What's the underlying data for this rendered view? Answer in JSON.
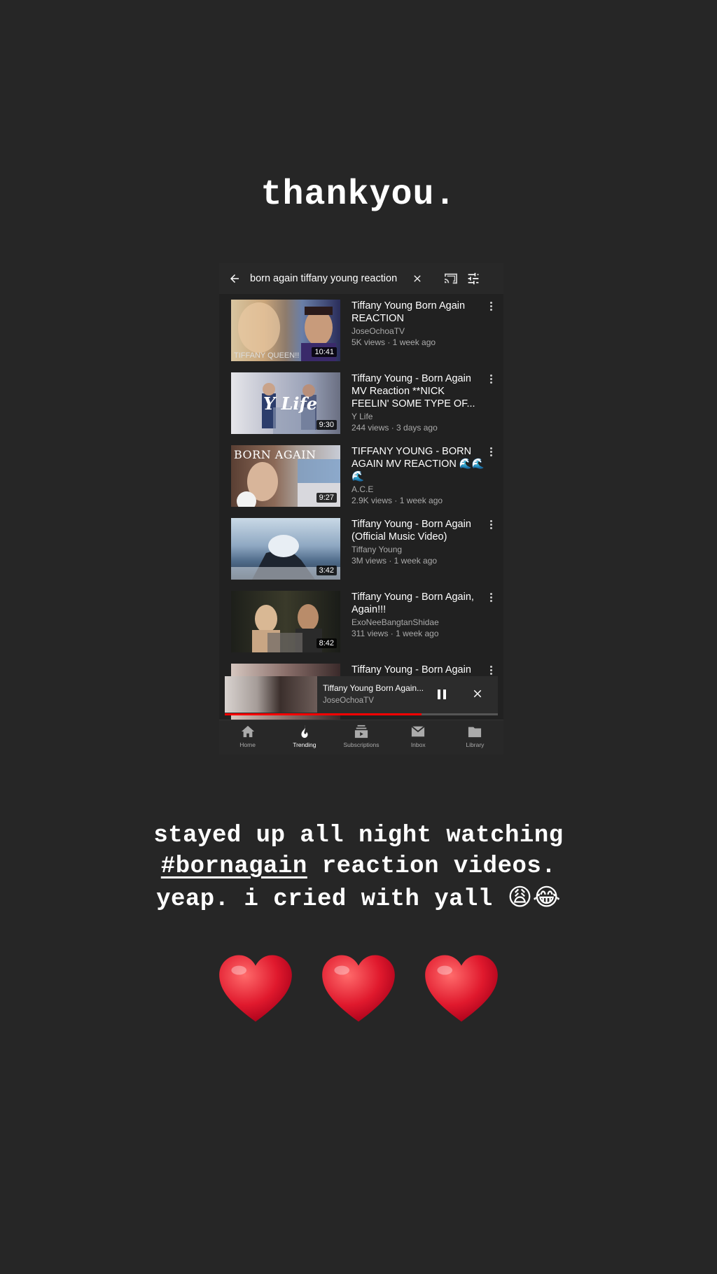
{
  "story": {
    "caption_top": "thankyou.",
    "caption_line1": "stayed up all night watching",
    "caption_hashtag": "#bornagain",
    "caption_line2_rest": " reaction videos.",
    "caption_line3": "yeap. i cried with yall ",
    "caption_line3_emoji": "😩😂"
  },
  "search": {
    "query": "born again tiffany young reaction"
  },
  "results": [
    {
      "title": "Tiffany Young Born Again REACTION",
      "channel": "JoseOchoaTV",
      "stats": "5K views · 1 week ago",
      "duration": "10:41",
      "thumb_text": "",
      "thumb_bottom": "TIFFANY QUEEN!!"
    },
    {
      "title": "Tiffany Young - Born Again MV Reaction **NICK FEELIN' SOME TYPE OF...",
      "channel": "Y Life",
      "stats": "244 views · 3 days ago",
      "duration": "9:30",
      "thumb_text": "Y Life",
      "thumb_bottom": ""
    },
    {
      "title": "TIFFANY YOUNG - BORN AGAIN MV REACTION 🌊🌊🌊",
      "channel": "A.C.E",
      "stats": "2.9K views · 1 week ago",
      "duration": "9:27",
      "thumb_text": "BORN AGAIN",
      "thumb_bottom": ""
    },
    {
      "title": "Tiffany Young - Born Again (Official Music Video)",
      "channel": "Tiffany Young",
      "stats": "3M views · 1 week ago",
      "duration": "3:42",
      "thumb_text": "",
      "thumb_bottom": ""
    },
    {
      "title": "Tiffany Young - Born Again, Again!!!",
      "channel": "ExoNeeBangtanShidae",
      "stats": "311 views · 1 week ago",
      "duration": "8:42",
      "thumb_text": "",
      "thumb_bottom": ""
    },
    {
      "title": "Tiffany Young - Born Again",
      "channel": "",
      "stats": "",
      "duration": "",
      "thumb_text": "",
      "thumb_bottom": ""
    }
  ],
  "miniplayer": {
    "title": "Tiffany Young Born Again...",
    "channel": "JoseOchoaTV",
    "progress": 0.72
  },
  "nav": [
    {
      "label": "Home",
      "icon": "home-icon"
    },
    {
      "label": "Trending",
      "icon": "trending-icon"
    },
    {
      "label": "Subscriptions",
      "icon": "subscriptions-icon"
    },
    {
      "label": "Inbox",
      "icon": "inbox-icon"
    },
    {
      "label": "Library",
      "icon": "library-icon"
    }
  ],
  "active_nav": "Trending",
  "colors": {
    "background": "#262626",
    "accent_red": "#ff0000",
    "heart": "#e0192d"
  }
}
